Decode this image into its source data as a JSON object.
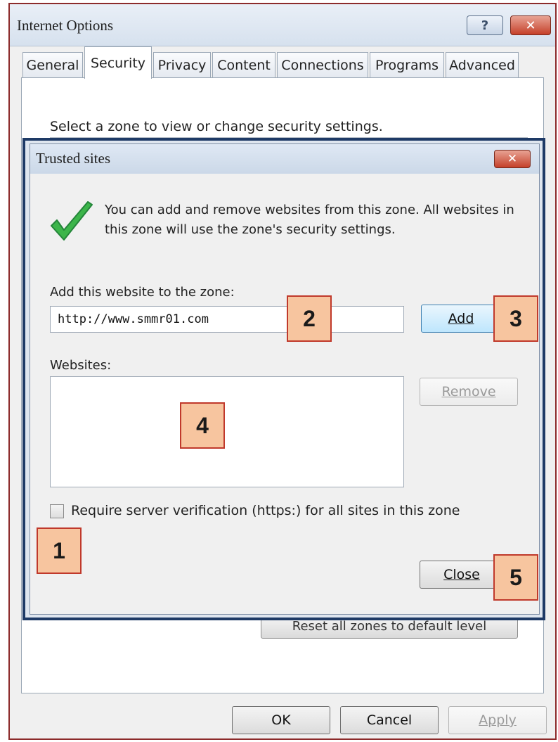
{
  "window": {
    "title": "Internet Options",
    "help_glyph": "?",
    "close_glyph": "✕"
  },
  "tabs": [
    {
      "label": "General"
    },
    {
      "label": "Security"
    },
    {
      "label": "Privacy"
    },
    {
      "label": "Content"
    },
    {
      "label": "Connections"
    },
    {
      "label": "Programs"
    },
    {
      "label": "Advanced"
    }
  ],
  "security": {
    "zone_prompt": "Select a zone to view or change security settings.",
    "reset_all_label": "Reset all zones to default level"
  },
  "footer": {
    "ok": "OK",
    "cancel": "Cancel",
    "apply": "Apply"
  },
  "trusted_dialog": {
    "title": "Trusted sites",
    "close_glyph": "✕",
    "info": "You can add and remove websites from this zone. All websites in this zone will use the zone's security settings.",
    "add_label": "Add this website to the zone:",
    "url_value": "http://www.smmr01.com",
    "add_button": "Add",
    "websites_label": "Websites:",
    "remove_button": "Remove",
    "require_https_label": "Require server verification (https:) for all sites in this zone",
    "require_https_checked": false,
    "close_button": "Close"
  },
  "callouts": [
    "1",
    "2",
    "3",
    "4",
    "5"
  ],
  "colors": {
    "callout_fill": "#f7c59f",
    "callout_border": "#c0392b",
    "highlight_frame": "#1e3a66",
    "check_green": "#3cb54a"
  },
  "icons": {
    "check": "checkmark-icon"
  }
}
